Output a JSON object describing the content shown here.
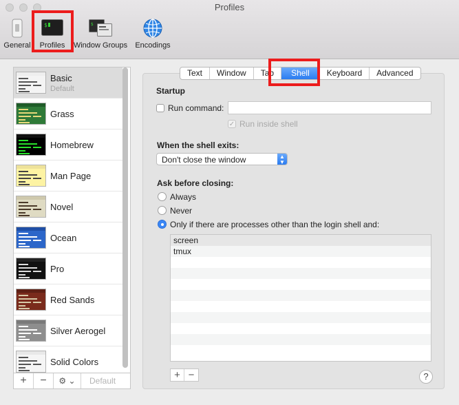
{
  "window": {
    "title": "Profiles"
  },
  "toolbar": {
    "items": [
      {
        "label": "General"
      },
      {
        "label": "Profiles"
      },
      {
        "label": "Window Groups"
      },
      {
        "label": "Encodings"
      }
    ],
    "highlight_color": "#ec1c1c"
  },
  "profiles": [
    {
      "name": "Basic",
      "subtitle": "Default",
      "bg": "#f4f4f4",
      "fg": "#555555",
      "bar": "#eeeeee"
    },
    {
      "name": "Grass",
      "bg": "#2f7a38",
      "fg": "#e8d97a",
      "bar": "#1f5c28"
    },
    {
      "name": "Homebrew",
      "bg": "#000000",
      "fg": "#29e02c",
      "bar": "#111111"
    },
    {
      "name": "Man Page",
      "bg": "#fdf3a3",
      "fg": "#444444",
      "bar": "#eee29a"
    },
    {
      "name": "Novel",
      "bg": "#dfdbc3",
      "fg": "#4b3a2a",
      "bar": "#cfc9ad"
    },
    {
      "name": "Ocean",
      "bg": "#2c66c9",
      "fg": "#ffffff",
      "bar": "#1f4fa6"
    },
    {
      "name": "Pro",
      "bg": "#111111",
      "fg": "#dddddd",
      "bar": "#222222"
    },
    {
      "name": "Red Sands",
      "bg": "#7a2b1c",
      "fg": "#d7c9a7",
      "bar": "#5e2015"
    },
    {
      "name": "Silver Aerogel",
      "bg": "#8e8e8e",
      "fg": "#ffffff",
      "bar": "#7a7a7a"
    },
    {
      "name": "Solid Colors",
      "bg": "#f5f5f5",
      "fg": "#555555",
      "bar": "#e8e8e8"
    }
  ],
  "list_footer": {
    "add": "+",
    "remove": "−",
    "gear": "⚙ ⌄",
    "default_label": "Default"
  },
  "tabs": [
    {
      "label": "Text"
    },
    {
      "label": "Window"
    },
    {
      "label": "Tab"
    },
    {
      "label": "Shell",
      "active": true
    },
    {
      "label": "Keyboard"
    },
    {
      "label": "Advanced"
    }
  ],
  "shell": {
    "startup_heading": "Startup",
    "run_command_label": "Run command:",
    "run_command_value": "",
    "run_inside_shell_label": "Run inside shell",
    "exit_heading": "When the shell exits:",
    "exit_option": "Don't close the window",
    "ask_heading": "Ask before closing:",
    "ask_options": [
      {
        "label": "Always",
        "selected": false
      },
      {
        "label": "Never",
        "selected": false
      },
      {
        "label": "Only if there are processes other than the login shell and:",
        "selected": true
      }
    ],
    "processes": [
      "screen",
      "tmux"
    ],
    "table_add": "+",
    "table_remove": "−",
    "help": "?"
  }
}
